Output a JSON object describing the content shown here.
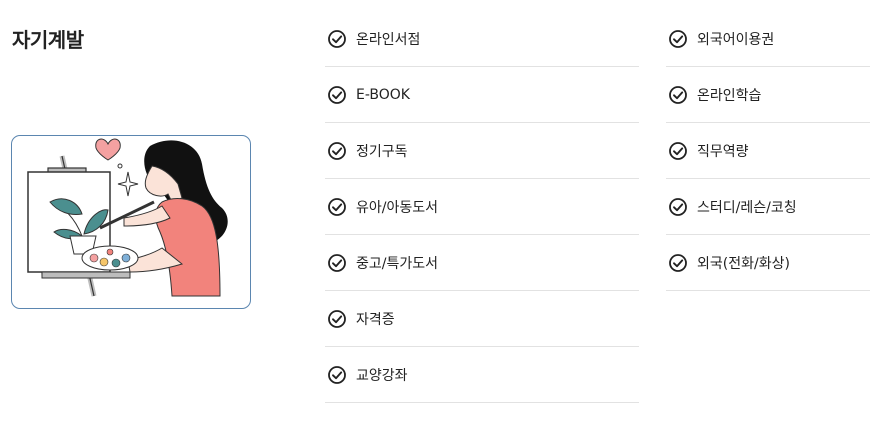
{
  "section": {
    "title": "자기계발"
  },
  "column1": [
    {
      "label": "온라인서점",
      "icon": "check-circle-icon"
    },
    {
      "label": "E-BOOK",
      "icon": "check-circle-icon"
    },
    {
      "label": "정기구독",
      "icon": "check-circle-icon"
    },
    {
      "label": "유아/아동도서",
      "icon": "check-circle-icon"
    },
    {
      "label": "중고/특가도서",
      "icon": "check-circle-icon"
    },
    {
      "label": "자격증",
      "icon": "check-circle-icon"
    },
    {
      "label": "교양강좌",
      "icon": "check-circle-icon"
    }
  ],
  "column2": [
    {
      "label": "외국어이용권",
      "icon": "check-circle-icon"
    },
    {
      "label": "온라인학습",
      "icon": "check-circle-icon"
    },
    {
      "label": "직무역량",
      "icon": "check-circle-icon"
    },
    {
      "label": "스터디/레슨/코칭",
      "icon": "check-circle-icon"
    },
    {
      "label": "외국(전화/화상)",
      "icon": "check-circle-icon"
    }
  ],
  "colors": {
    "accent_border": "#5b86b0",
    "shirt": "#f2837c",
    "heart": "#f4a1a1",
    "divider": "#e2e2e2"
  }
}
